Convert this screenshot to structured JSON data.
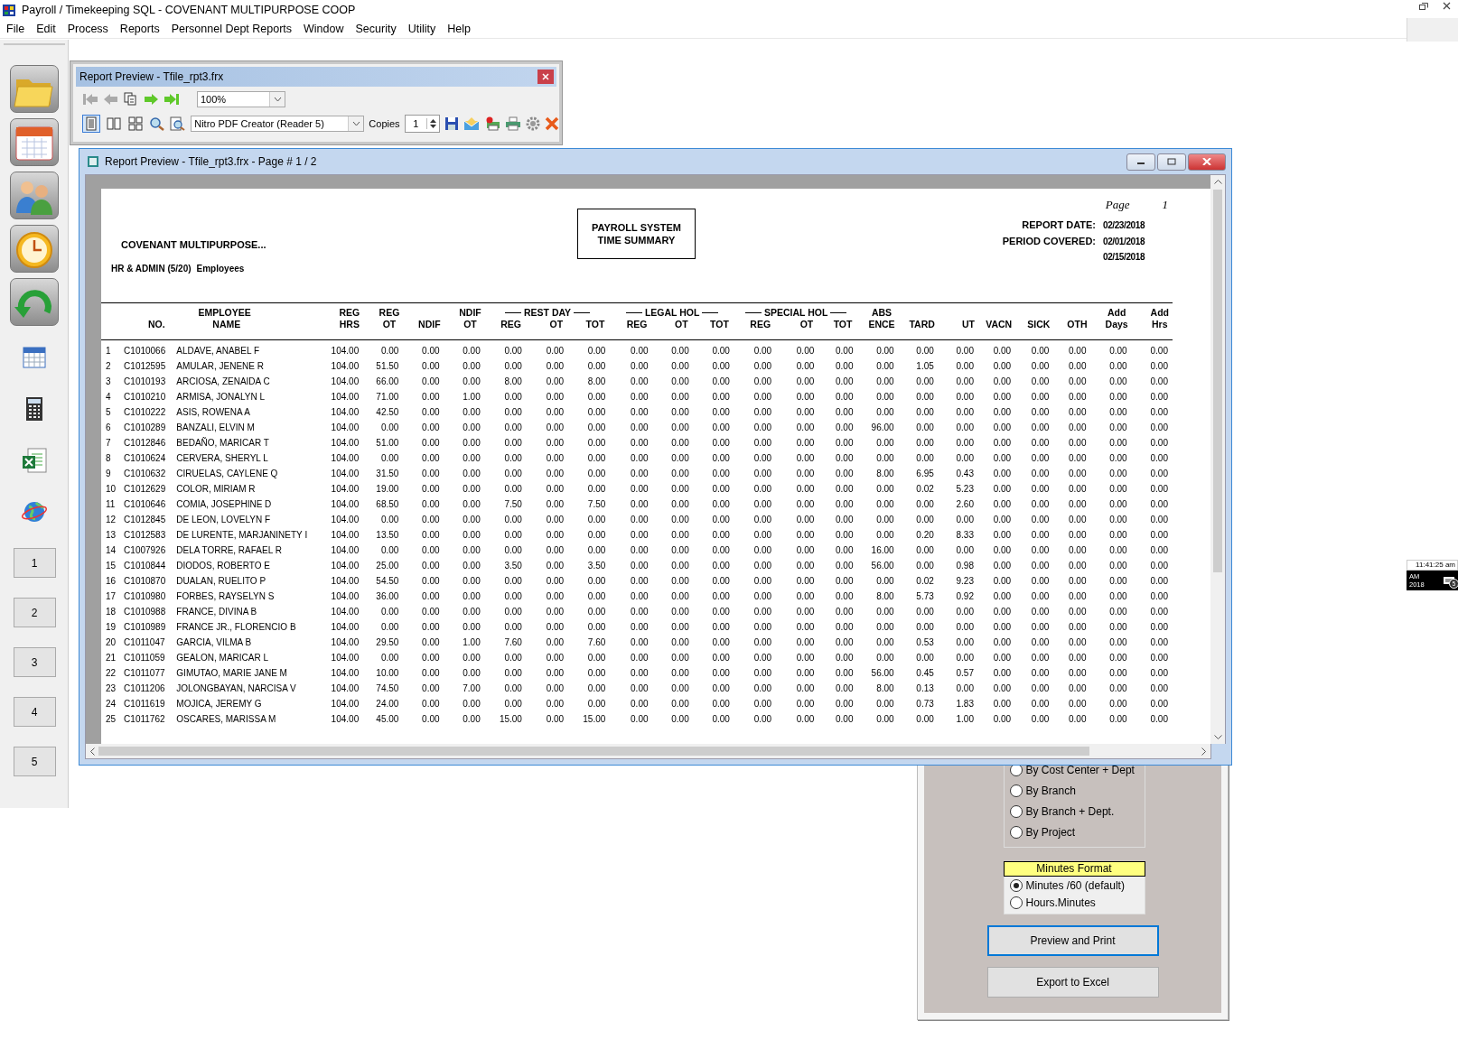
{
  "window": {
    "title": "Payroll / Timekeeping SQL - COVENANT MULTIPURPOSE COOP"
  },
  "menu": [
    "File",
    "Edit",
    "Process",
    "Reports",
    "Personnel Dept Reports",
    "Window",
    "Security",
    "Utility",
    "Help"
  ],
  "sidebar": {
    "number_buttons": [
      "1",
      "2",
      "3",
      "4",
      "5"
    ]
  },
  "toolbar_window": {
    "title": "Report Preview - Tfile_rpt3.frx",
    "zoom": "100%",
    "printer": "Nitro PDF Creator (Reader 5)",
    "copies_label": "Copies",
    "copies": "1",
    "view_buttons": [
      {
        "selected": true
      },
      {
        "selected": false
      },
      {
        "selected": false
      }
    ]
  },
  "preview_window": {
    "title": "Report Preview - Tfile_rpt3.frx - Page # 1 / 2",
    "report": {
      "page_label": "Page",
      "page_number": "1",
      "company": "COVENANT MULTIPURPOSE...",
      "department": "HR & ADMIN (5/20)",
      "department_suffix": "Employees",
      "title_lines": [
        "PAYROLL SYSTEM",
        "TIME SUMMARY"
      ],
      "report_date_label": "REPORT DATE:",
      "report_date": "02/23/2018",
      "period_label": "PERIOD COVERED:",
      "period_from": "02/01/2018",
      "period_to": "02/15/2018",
      "column_groups": [
        {
          "kind": "plain",
          "label": "EMPLOYEE",
          "columns": [
            [
              "NO."
            ],
            [
              "NAME"
            ]
          ]
        },
        {
          "kind": "single",
          "columns": [
            [
              "REG",
              "HRS"
            ]
          ]
        },
        {
          "kind": "single",
          "columns": [
            [
              "REG",
              "OT"
            ]
          ]
        },
        {
          "kind": "single",
          "columns": [
            [
              "NDIF"
            ]
          ]
        },
        {
          "kind": "single",
          "columns": [
            [
              "NDIF",
              "OT"
            ]
          ]
        },
        {
          "kind": "ruled",
          "label": "REST DAY",
          "columns": [
            [
              "REG"
            ],
            [
              "OT"
            ],
            [
              "TOT"
            ]
          ]
        },
        {
          "kind": "ruled",
          "label": "LEGAL HOL",
          "columns": [
            [
              "REG"
            ],
            [
              "OT"
            ],
            [
              "TOT"
            ]
          ]
        },
        {
          "kind": "ruled",
          "label": "SPECIAL HOL",
          "columns": [
            [
              "REG"
            ],
            [
              "OT"
            ],
            [
              "TOT"
            ]
          ]
        },
        {
          "kind": "single",
          "columns": [
            [
              "ABS",
              "ENCE"
            ]
          ]
        },
        {
          "kind": "single",
          "columns": [
            [
              "TARD"
            ]
          ]
        },
        {
          "kind": "single",
          "columns": [
            [
              "UT"
            ]
          ]
        },
        {
          "kind": "single",
          "columns": [
            [
              "VACN"
            ]
          ]
        },
        {
          "kind": "single",
          "columns": [
            [
              "SICK"
            ]
          ]
        },
        {
          "kind": "single",
          "columns": [
            [
              "OTH"
            ]
          ]
        },
        {
          "kind": "single",
          "columns": [
            [
              "Add",
              "Days"
            ]
          ]
        },
        {
          "kind": "single",
          "columns": [
            [
              "Add",
              "Hrs"
            ]
          ]
        }
      ],
      "rows": [
        {
          "no": "1",
          "id": "C1010066",
          "name": "ALDAVE, ANABEL F",
          "values": [
            "104.00",
            "0.00",
            "0.00",
            "0.00",
            "0.00",
            "0.00",
            "0.00",
            "0.00",
            "0.00",
            "0.00",
            "0.00",
            "0.00",
            "0.00",
            "0.00",
            "0.00",
            "0.00",
            "0.00",
            "0.00",
            "0.00",
            "0.00",
            "0.00"
          ]
        },
        {
          "no": "2",
          "id": "C1012595",
          "name": "AMULAR, JENENE R",
          "values": [
            "104.00",
            "51.50",
            "0.00",
            "0.00",
            "0.00",
            "0.00",
            "0.00",
            "0.00",
            "0.00",
            "0.00",
            "0.00",
            "0.00",
            "0.00",
            "0.00",
            "1.05",
            "0.00",
            "0.00",
            "0.00",
            "0.00",
            "0.00",
            "0.00"
          ]
        },
        {
          "no": "3",
          "id": "C1010193",
          "name": "ARCIOSA, ZENAIDA C",
          "values": [
            "104.00",
            "66.00",
            "0.00",
            "0.00",
            "8.00",
            "0.00",
            "8.00",
            "0.00",
            "0.00",
            "0.00",
            "0.00",
            "0.00",
            "0.00",
            "0.00",
            "0.00",
            "0.00",
            "0.00",
            "0.00",
            "0.00",
            "0.00",
            "0.00"
          ]
        },
        {
          "no": "4",
          "id": "C1010210",
          "name": "ARMISA, JONALYN L",
          "values": [
            "104.00",
            "71.00",
            "0.00",
            "1.00",
            "0.00",
            "0.00",
            "0.00",
            "0.00",
            "0.00",
            "0.00",
            "0.00",
            "0.00",
            "0.00",
            "0.00",
            "0.00",
            "0.00",
            "0.00",
            "0.00",
            "0.00",
            "0.00",
            "0.00"
          ]
        },
        {
          "no": "5",
          "id": "C1010222",
          "name": "ASIS, ROWENA A",
          "values": [
            "104.00",
            "42.50",
            "0.00",
            "0.00",
            "0.00",
            "0.00",
            "0.00",
            "0.00",
            "0.00",
            "0.00",
            "0.00",
            "0.00",
            "0.00",
            "0.00",
            "0.00",
            "0.00",
            "0.00",
            "0.00",
            "0.00",
            "0.00",
            "0.00"
          ]
        },
        {
          "no": "6",
          "id": "C1010289",
          "name": "BANZALI, ELVIN M",
          "values": [
            "104.00",
            "0.00",
            "0.00",
            "0.00",
            "0.00",
            "0.00",
            "0.00",
            "0.00",
            "0.00",
            "0.00",
            "0.00",
            "0.00",
            "0.00",
            "96.00",
            "0.00",
            "0.00",
            "0.00",
            "0.00",
            "0.00",
            "0.00",
            "0.00"
          ]
        },
        {
          "no": "7",
          "id": "C1012846",
          "name": "BEDAÑO, MARICAR T",
          "values": [
            "104.00",
            "51.00",
            "0.00",
            "0.00",
            "0.00",
            "0.00",
            "0.00",
            "0.00",
            "0.00",
            "0.00",
            "0.00",
            "0.00",
            "0.00",
            "0.00",
            "0.00",
            "0.00",
            "0.00",
            "0.00",
            "0.00",
            "0.00",
            "0.00"
          ]
        },
        {
          "no": "8",
          "id": "C1010624",
          "name": "CERVERA, SHERYL L",
          "values": [
            "104.00",
            "0.00",
            "0.00",
            "0.00",
            "0.00",
            "0.00",
            "0.00",
            "0.00",
            "0.00",
            "0.00",
            "0.00",
            "0.00",
            "0.00",
            "0.00",
            "0.00",
            "0.00",
            "0.00",
            "0.00",
            "0.00",
            "0.00",
            "0.00"
          ]
        },
        {
          "no": "9",
          "id": "C1010632",
          "name": "CIRUELAS, CAYLENE Q",
          "values": [
            "104.00",
            "31.50",
            "0.00",
            "0.00",
            "0.00",
            "0.00",
            "0.00",
            "0.00",
            "0.00",
            "0.00",
            "0.00",
            "0.00",
            "0.00",
            "8.00",
            "6.95",
            "0.43",
            "0.00",
            "0.00",
            "0.00",
            "0.00",
            "0.00"
          ]
        },
        {
          "no": "10",
          "id": "C1012629",
          "name": "COLOR, MIRIAM R",
          "values": [
            "104.00",
            "19.00",
            "0.00",
            "0.00",
            "0.00",
            "0.00",
            "0.00",
            "0.00",
            "0.00",
            "0.00",
            "0.00",
            "0.00",
            "0.00",
            "0.00",
            "0.02",
            "5.23",
            "0.00",
            "0.00",
            "0.00",
            "0.00",
            "0.00"
          ]
        },
        {
          "no": "11",
          "id": "C1010646",
          "name": "COMIA, JOSEPHINE D",
          "values": [
            "104.00",
            "68.50",
            "0.00",
            "0.00",
            "7.50",
            "0.00",
            "7.50",
            "0.00",
            "0.00",
            "0.00",
            "0.00",
            "0.00",
            "0.00",
            "0.00",
            "0.00",
            "2.60",
            "0.00",
            "0.00",
            "0.00",
            "0.00",
            "0.00"
          ]
        },
        {
          "no": "12",
          "id": "C1012845",
          "name": "DE LEON, LOVELYN F",
          "values": [
            "104.00",
            "0.00",
            "0.00",
            "0.00",
            "0.00",
            "0.00",
            "0.00",
            "0.00",
            "0.00",
            "0.00",
            "0.00",
            "0.00",
            "0.00",
            "0.00",
            "0.00",
            "0.00",
            "0.00",
            "0.00",
            "0.00",
            "0.00",
            "0.00"
          ]
        },
        {
          "no": "13",
          "id": "C1012583",
          "name": "DE LURENTE, MARJANINETY I",
          "values": [
            "104.00",
            "13.50",
            "0.00",
            "0.00",
            "0.00",
            "0.00",
            "0.00",
            "0.00",
            "0.00",
            "0.00",
            "0.00",
            "0.00",
            "0.00",
            "0.00",
            "0.20",
            "8.33",
            "0.00",
            "0.00",
            "0.00",
            "0.00",
            "0.00"
          ]
        },
        {
          "no": "14",
          "id": "C1007926",
          "name": "DELA TORRE, RAFAEL R",
          "values": [
            "104.00",
            "0.00",
            "0.00",
            "0.00",
            "0.00",
            "0.00",
            "0.00",
            "0.00",
            "0.00",
            "0.00",
            "0.00",
            "0.00",
            "0.00",
            "16.00",
            "0.00",
            "0.00",
            "0.00",
            "0.00",
            "0.00",
            "0.00",
            "0.00"
          ]
        },
        {
          "no": "15",
          "id": "C1010844",
          "name": "DIODOS, ROBERTO E",
          "values": [
            "104.00",
            "25.00",
            "0.00",
            "0.00",
            "3.50",
            "0.00",
            "3.50",
            "0.00",
            "0.00",
            "0.00",
            "0.00",
            "0.00",
            "0.00",
            "56.00",
            "0.00",
            "0.98",
            "0.00",
            "0.00",
            "0.00",
            "0.00",
            "0.00"
          ]
        },
        {
          "no": "16",
          "id": "C1010870",
          "name": "DUALAN, RUELITO P",
          "values": [
            "104.00",
            "54.50",
            "0.00",
            "0.00",
            "0.00",
            "0.00",
            "0.00",
            "0.00",
            "0.00",
            "0.00",
            "0.00",
            "0.00",
            "0.00",
            "0.00",
            "0.02",
            "9.23",
            "0.00",
            "0.00",
            "0.00",
            "0.00",
            "0.00"
          ]
        },
        {
          "no": "17",
          "id": "C1010980",
          "name": "FORBES, RAYSELYN S",
          "values": [
            "104.00",
            "36.00",
            "0.00",
            "0.00",
            "0.00",
            "0.00",
            "0.00",
            "0.00",
            "0.00",
            "0.00",
            "0.00",
            "0.00",
            "0.00",
            "8.00",
            "5.73",
            "0.92",
            "0.00",
            "0.00",
            "0.00",
            "0.00",
            "0.00"
          ]
        },
        {
          "no": "18",
          "id": "C1010988",
          "name": "FRANCE, DIVINA B",
          "values": [
            "104.00",
            "0.00",
            "0.00",
            "0.00",
            "0.00",
            "0.00",
            "0.00",
            "0.00",
            "0.00",
            "0.00",
            "0.00",
            "0.00",
            "0.00",
            "0.00",
            "0.00",
            "0.00",
            "0.00",
            "0.00",
            "0.00",
            "0.00",
            "0.00"
          ]
        },
        {
          "no": "19",
          "id": "C1010989",
          "name": "FRANCE JR., FLORENCIO B",
          "values": [
            "104.00",
            "0.00",
            "0.00",
            "0.00",
            "0.00",
            "0.00",
            "0.00",
            "0.00",
            "0.00",
            "0.00",
            "0.00",
            "0.00",
            "0.00",
            "0.00",
            "0.00",
            "0.00",
            "0.00",
            "0.00",
            "0.00",
            "0.00",
            "0.00"
          ]
        },
        {
          "no": "20",
          "id": "C1011047",
          "name": "GARCIA, VILMA B",
          "values": [
            "104.00",
            "29.50",
            "0.00",
            "1.00",
            "7.60",
            "0.00",
            "7.60",
            "0.00",
            "0.00",
            "0.00",
            "0.00",
            "0.00",
            "0.00",
            "0.00",
            "0.53",
            "0.00",
            "0.00",
            "0.00",
            "0.00",
            "0.00",
            "0.00"
          ]
        },
        {
          "no": "21",
          "id": "C1011059",
          "name": "GEALON, MARICAR L",
          "values": [
            "104.00",
            "0.00",
            "0.00",
            "0.00",
            "0.00",
            "0.00",
            "0.00",
            "0.00",
            "0.00",
            "0.00",
            "0.00",
            "0.00",
            "0.00",
            "0.00",
            "0.00",
            "0.00",
            "0.00",
            "0.00",
            "0.00",
            "0.00",
            "0.00"
          ]
        },
        {
          "no": "22",
          "id": "C1011077",
          "name": "GIMUTAO, MARIE JANE M",
          "values": [
            "104.00",
            "10.00",
            "0.00",
            "0.00",
            "0.00",
            "0.00",
            "0.00",
            "0.00",
            "0.00",
            "0.00",
            "0.00",
            "0.00",
            "0.00",
            "56.00",
            "0.45",
            "0.57",
            "0.00",
            "0.00",
            "0.00",
            "0.00",
            "0.00"
          ]
        },
        {
          "no": "23",
          "id": "C1011206",
          "name": "JOLONGBAYAN, NARCISA V",
          "values": [
            "104.00",
            "74.50",
            "0.00",
            "7.00",
            "0.00",
            "0.00",
            "0.00",
            "0.00",
            "0.00",
            "0.00",
            "0.00",
            "0.00",
            "0.00",
            "8.00",
            "0.13",
            "0.00",
            "0.00",
            "0.00",
            "0.00",
            "0.00",
            "0.00"
          ]
        },
        {
          "no": "24",
          "id": "C1011619",
          "name": "MOJICA, JEREMY G",
          "values": [
            "104.00",
            "24.00",
            "0.00",
            "0.00",
            "0.00",
            "0.00",
            "0.00",
            "0.00",
            "0.00",
            "0.00",
            "0.00",
            "0.00",
            "0.00",
            "0.00",
            "0.73",
            "1.83",
            "0.00",
            "0.00",
            "0.00",
            "0.00",
            "0.00"
          ]
        },
        {
          "no": "25",
          "id": "C1011762",
          "name": "OSCARES, MARISSA M",
          "values": [
            "104.00",
            "45.00",
            "0.00",
            "0.00",
            "15.00",
            "0.00",
            "15.00",
            "0.00",
            "0.00",
            "0.00",
            "0.00",
            "0.00",
            "0.00",
            "0.00",
            "0.00",
            "1.00",
            "0.00",
            "0.00",
            "0.00",
            "0.00",
            "0.00"
          ]
        }
      ]
    }
  },
  "options_panel": {
    "group_options": [
      {
        "label": "By Cost Center + Dept",
        "selected": false
      },
      {
        "label": "By Branch",
        "selected": false
      },
      {
        "label": "By Branch + Dept.",
        "selected": false
      },
      {
        "label": "By Project",
        "selected": false
      }
    ],
    "minutes_format": {
      "title": "Minutes Format",
      "options": [
        {
          "label": "Minutes /60   (default)",
          "selected": true
        },
        {
          "label": "Hours.Minutes",
          "selected": false
        }
      ]
    },
    "buttons": [
      {
        "label": "Preview and Print",
        "focused": true
      },
      {
        "label": "Export to Excel",
        "focused": false
      }
    ]
  },
  "tray": {
    "time": "11:41:25 am",
    "line1": "AM",
    "line2": "2018",
    "badge": "5"
  }
}
